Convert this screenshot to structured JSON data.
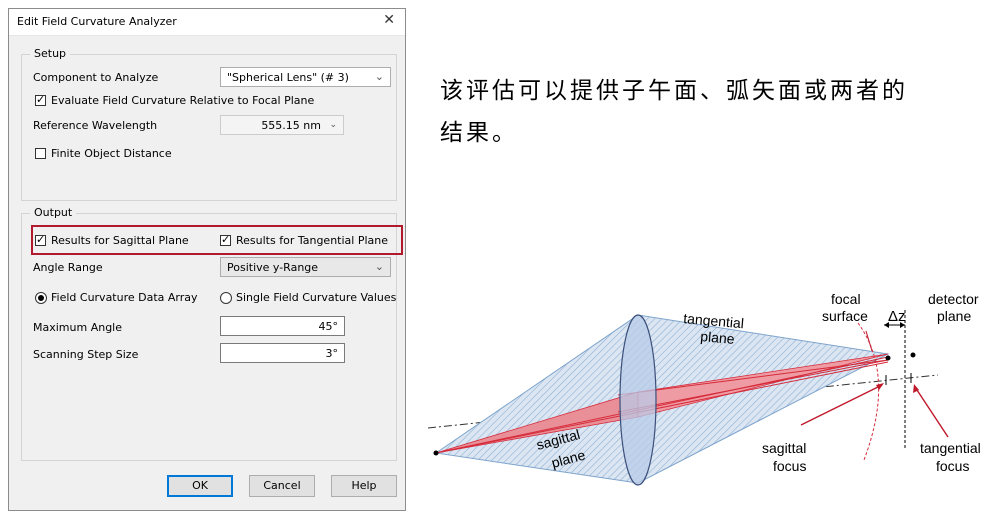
{
  "dialog": {
    "title": "Edit Field Curvature Analyzer",
    "setup": {
      "group_title": "Setup",
      "component_label": "Component to Analyze",
      "component_value": "\"Spherical Lens\" (# 3)",
      "evaluate_relative_label": "Evaluate Field Curvature Relative to Focal Plane",
      "evaluate_relative_checked": true,
      "ref_wavelength_label": "Reference Wavelength",
      "ref_wavelength_value": "555.15 nm",
      "finite_object_label": "Finite Object Distance",
      "finite_object_checked": false
    },
    "output": {
      "group_title": "Output",
      "sagittal_label": "Results for Sagittal Plane",
      "sagittal_checked": true,
      "tangential_label": "Results for Tangential Plane",
      "tangential_checked": true,
      "angle_range_label": "Angle Range",
      "angle_range_value": "Positive y-Range",
      "radio_array_label": "Field Curvature Data Array",
      "radio_array_selected": true,
      "radio_single_label": "Single Field Curvature Values",
      "radio_single_selected": false,
      "max_angle_label": "Maximum Angle",
      "max_angle_value": "45°",
      "step_size_label": "Scanning Step Size",
      "step_size_value": "3°"
    },
    "buttons": {
      "ok": "OK",
      "cancel": "Cancel",
      "help": "Help"
    },
    "highlight_color": "#b11a2c"
  },
  "description": {
    "line1": "该评估可以提供子午面、弧矢面或两者的",
    "line2": "结果。"
  },
  "diagram": {
    "tangential_label_1": "tangential",
    "tangential_label_2": "plane",
    "sagittal_label_1": "sagittal",
    "sagittal_label_2": "plane",
    "focal_surface_1": "focal",
    "focal_surface_2": "surface",
    "delta_z": "Δz",
    "detector_plane_1": "detector",
    "detector_plane_2": "plane",
    "sagittal_focus_1": "sagittal",
    "sagittal_focus_2": "focus",
    "tangential_focus_1": "tangential",
    "tangential_focus_2": "focus",
    "colors": {
      "tangential_fill": "#a9c3de",
      "sagittal_fill": "#e0303a",
      "lens": "#8fa9d8"
    }
  }
}
